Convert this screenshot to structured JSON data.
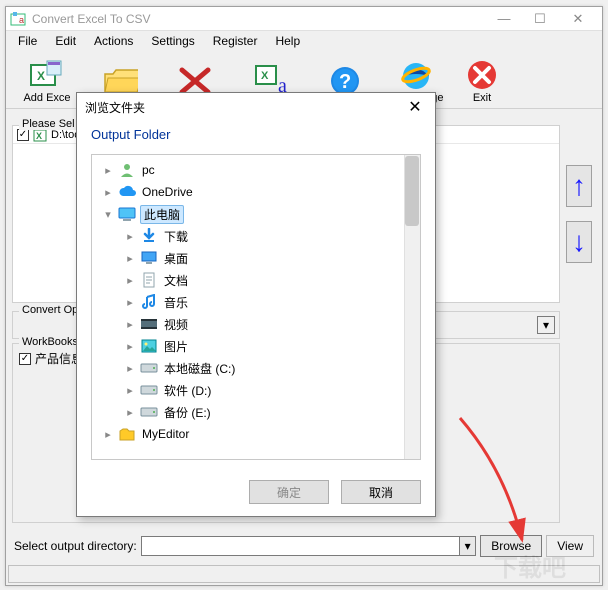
{
  "window": {
    "title": "Convert Excel To CSV",
    "controls": {
      "min": "—",
      "max": "☐",
      "close": "✕"
    }
  },
  "menu": [
    "File",
    "Edit",
    "Actions",
    "Settings",
    "Register",
    "Help"
  ],
  "toolbar": [
    {
      "name": "add-excel",
      "label": "Add Exce",
      "icon": "excel"
    },
    {
      "name": "open-folder",
      "label": "",
      "icon": "folder"
    },
    {
      "name": "delete",
      "label": "",
      "icon": "x-red"
    },
    {
      "name": "excel-txt",
      "label": "",
      "icon": "excel-a"
    },
    {
      "name": "help",
      "label": "",
      "icon": "help"
    },
    {
      "name": "homepage",
      "label": "HomePage",
      "icon": "ie"
    },
    {
      "name": "exit",
      "label": "Exit",
      "icon": "exit"
    }
  ],
  "list": {
    "header": "Please Sel",
    "rows": [
      {
        "path": "D:\\tools\\"
      }
    ]
  },
  "convert_op_label": "Convert Op",
  "convert_combo_caret": "▾",
  "workbooks": {
    "label": "WorkBooks",
    "item": "产品信息",
    "checked": true
  },
  "output": {
    "label": "Select  output directory:",
    "value": "",
    "browse": "Browse",
    "view": "View",
    "caret": "▾"
  },
  "arrows": {
    "up": "↑",
    "down": "↓"
  },
  "dialog": {
    "title": "浏览文件夹",
    "close": "✕",
    "heading": "Output Folder",
    "tree": [
      {
        "depth": 0,
        "toggle": "▸",
        "icon": "user",
        "label": "pc",
        "selected": false
      },
      {
        "depth": 0,
        "toggle": "▸",
        "icon": "cloud",
        "label": "OneDrive",
        "selected": false
      },
      {
        "depth": 0,
        "toggle": "▾",
        "icon": "computer",
        "label": "此电脑",
        "selected": true
      },
      {
        "depth": 1,
        "toggle": "▸",
        "icon": "download",
        "label": "下载",
        "selected": false
      },
      {
        "depth": 1,
        "toggle": "▸",
        "icon": "desktop",
        "label": "桌面",
        "selected": false
      },
      {
        "depth": 1,
        "toggle": "▸",
        "icon": "doc",
        "label": "文档",
        "selected": false
      },
      {
        "depth": 1,
        "toggle": "▸",
        "icon": "music",
        "label": "音乐",
        "selected": false
      },
      {
        "depth": 1,
        "toggle": "▸",
        "icon": "video",
        "label": "视频",
        "selected": false
      },
      {
        "depth": 1,
        "toggle": "▸",
        "icon": "picture",
        "label": "图片",
        "selected": false
      },
      {
        "depth": 1,
        "toggle": "▸",
        "icon": "disk",
        "label": "本地磁盘 (C:)",
        "selected": false
      },
      {
        "depth": 1,
        "toggle": "▸",
        "icon": "disk",
        "label": "软件 (D:)",
        "selected": false
      },
      {
        "depth": 1,
        "toggle": "▸",
        "icon": "disk",
        "label": "备份 (E:)",
        "selected": false
      },
      {
        "depth": 0,
        "toggle": "▸",
        "icon": "folder",
        "label": "MyEditor",
        "selected": false
      }
    ],
    "ok": "确定",
    "cancel": "取消"
  }
}
